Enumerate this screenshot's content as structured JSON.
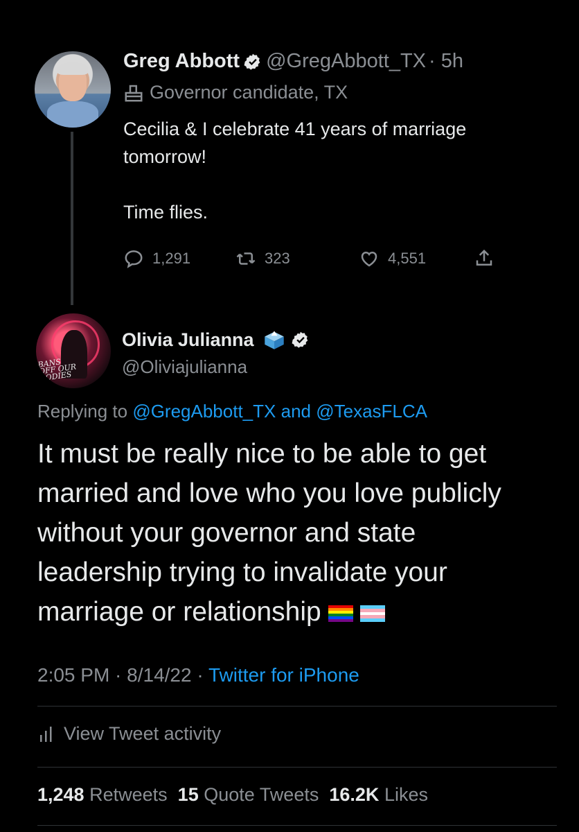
{
  "parent_tweet": {
    "author_name": "Greg Abbott",
    "handle": "@GregAbbott_TX",
    "time": "· 5h",
    "label": "Governor candidate, TX",
    "text_line1": "Cecilia & I celebrate 41 years of marriage",
    "text_line2": "tomorrow!",
    "text_line3": "Time flies.",
    "replies": "1,291",
    "retweets": "323",
    "likes": "4,551"
  },
  "reply_tweet": {
    "author_name": "Olivia Julianna",
    "handle": "@Oliviajulianna",
    "avatar_text": "BANS OFF OUR BODIES",
    "replying_prefix": "Replying to",
    "replying_to_1": "@GregAbbott_TX",
    "replying_and": "and",
    "replying_to_2": "@TexasFLCA",
    "text_lines": [
      "It must be really nice to be able to get",
      "married and love who you love publicly",
      "without your governor and state",
      "leadership trying to invalidate your",
      "marriage or relationship"
    ],
    "time": "2:05 PM · 8/14/22 ·",
    "source": "Twitter for iPhone",
    "view_activity": "View Tweet activity",
    "retweets_count": "1,248",
    "retweets_label": "Retweets",
    "quotes_count": "15",
    "quotes_label": "Quote Tweets",
    "likes_count": "16.2K",
    "likes_label": "Likes"
  },
  "colors": {
    "background": "#000000",
    "text": "#e7e9ea",
    "muted": "#8b8f94",
    "link": "#1d9bf0",
    "divider": "#2f3336"
  },
  "icons": [
    "verified-badge-icon",
    "ballot-box-icon",
    "reply-icon",
    "retweet-icon",
    "like-icon",
    "share-icon",
    "bar-chart-icon",
    "rainbow-flag-icon",
    "transgender-flag-icon"
  ]
}
